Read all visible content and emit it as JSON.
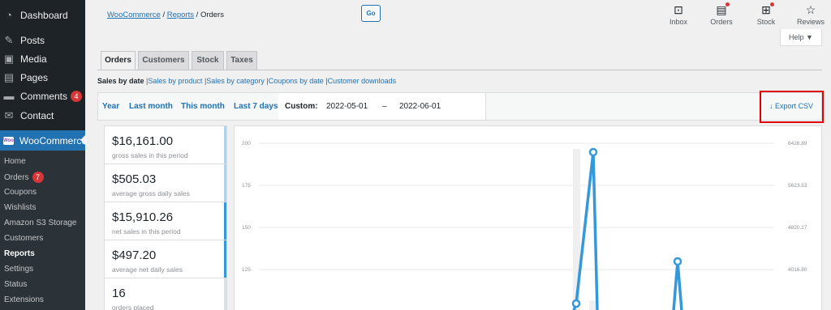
{
  "sidebar": {
    "items": [
      {
        "label": "Dashboard",
        "icon": "dashboard-icon"
      },
      {
        "label": "Posts",
        "icon": "pin-icon"
      },
      {
        "label": "Media",
        "icon": "media-icon"
      },
      {
        "label": "Pages",
        "icon": "pages-icon"
      },
      {
        "label": "Comments",
        "icon": "comment-icon",
        "badge": "4"
      },
      {
        "label": "Contact",
        "icon": "mail-icon"
      }
    ],
    "woocommerce_label": "WooCommerce",
    "woo_logo_text": "Woo",
    "submenu": [
      {
        "label": "Home"
      },
      {
        "label": "Orders",
        "badge": "7"
      },
      {
        "label": "Coupons"
      },
      {
        "label": "Wishlists"
      },
      {
        "label": "Amazon S3 Storage"
      },
      {
        "label": "Customers"
      },
      {
        "label": "Reports",
        "current": true
      },
      {
        "label": "Settings"
      },
      {
        "label": "Status"
      },
      {
        "label": "Extensions"
      }
    ]
  },
  "header": {
    "breadcrumb": {
      "woocommerce": "WooCommerce",
      "reports": "Reports",
      "orders": "Orders",
      "sep": "/"
    },
    "icons": [
      {
        "label": "Inbox",
        "icon": "inbox-icon"
      },
      {
        "label": "Orders",
        "icon": "orders-icon"
      },
      {
        "label": "Stock",
        "icon": "stock-icon"
      },
      {
        "label": "Reviews",
        "icon": "star-icon"
      }
    ],
    "help_label": "Help ▼"
  },
  "tabs": [
    {
      "label": "Orders",
      "active": true
    },
    {
      "label": "Customers"
    },
    {
      "label": "Stock"
    },
    {
      "label": "Taxes"
    }
  ],
  "sublinks": {
    "current": "Sales by date",
    "links": [
      "Sales by product",
      "Sales by category",
      "Coupons by date",
      "Customer downloads"
    ],
    "sep": "|"
  },
  "ranges": {
    "year": "Year",
    "last_month": "Last month",
    "this_month": "This month",
    "last_7_days": "Last 7 days",
    "custom_label": "Custom:",
    "start_date": "2022-05-01",
    "dash": "–",
    "end_date": "2022-06-01",
    "go_label": "Go",
    "export_label": "Export CSV"
  },
  "stats": [
    {
      "amount": "$16,161.00",
      "desc": "gross sales in this period",
      "color": "#b1d4ea"
    },
    {
      "amount": "$505.03",
      "desc": "average gross daily sales",
      "color": "#b1d4ea"
    },
    {
      "amount": "$15,910.26",
      "desc": "net sales in this period",
      "color": "#3498db"
    },
    {
      "amount": "$497.20",
      "desc": "average net daily sales",
      "color": "#3498db"
    },
    {
      "amount": "16",
      "desc": "orders placed",
      "color": "#dbe1e3"
    }
  ],
  "chart": {
    "left_ticks": [
      "200",
      "175",
      "150",
      "125"
    ],
    "right_ticks": [
      "6426.89",
      "5623.53",
      "4820.17",
      "4016.80"
    ],
    "line_color": "#3498db"
  }
}
